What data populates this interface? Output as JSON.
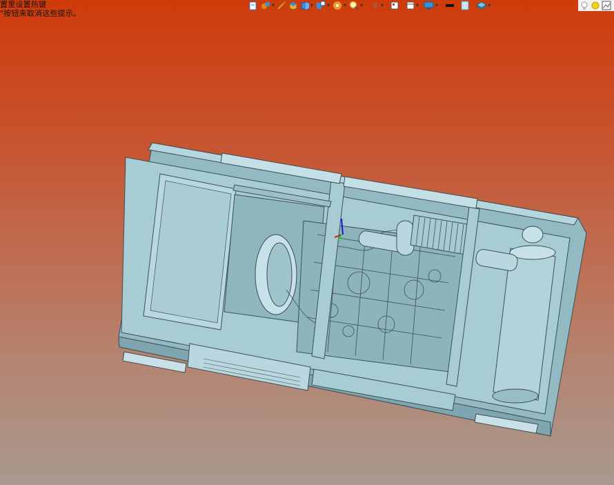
{
  "hint": {
    "line1": "置里设置热键",
    "line2": "\"按钮来取消这些提示。"
  },
  "toolbar": {
    "buttons": [
      {
        "name": "view-orientation-icon",
        "color": "#3b7bd4"
      },
      {
        "name": "display-style-icon",
        "color": "#d98a1c"
      },
      {
        "name": "sketch-icon",
        "color": "#c9a227"
      },
      {
        "name": "box-icon",
        "color": "#e8b23a"
      },
      {
        "name": "section-view-icon",
        "color": "#3a8ede"
      },
      {
        "name": "hide-show-icon",
        "color": "#3a8ede"
      },
      {
        "name": "appearance-icon",
        "color": "#e89a2a"
      },
      {
        "name": "zoom-icon",
        "color": "#d9a62a"
      },
      {
        "name": "rotate-icon",
        "color": "#777777"
      },
      {
        "name": "standard-views-icon",
        "color": "#555555"
      },
      {
        "name": "view-window-icon",
        "color": "#555555"
      },
      {
        "name": "monitor-icon",
        "color": "#3a8ede"
      }
    ],
    "color_swatch_dark": "#111111",
    "color_swatch_light": "#cfe6f5",
    "layer_color": "#4aa3c8"
  },
  "model": {
    "body_color": "#9fc4cc",
    "edge_color": "#3b4e54"
  }
}
